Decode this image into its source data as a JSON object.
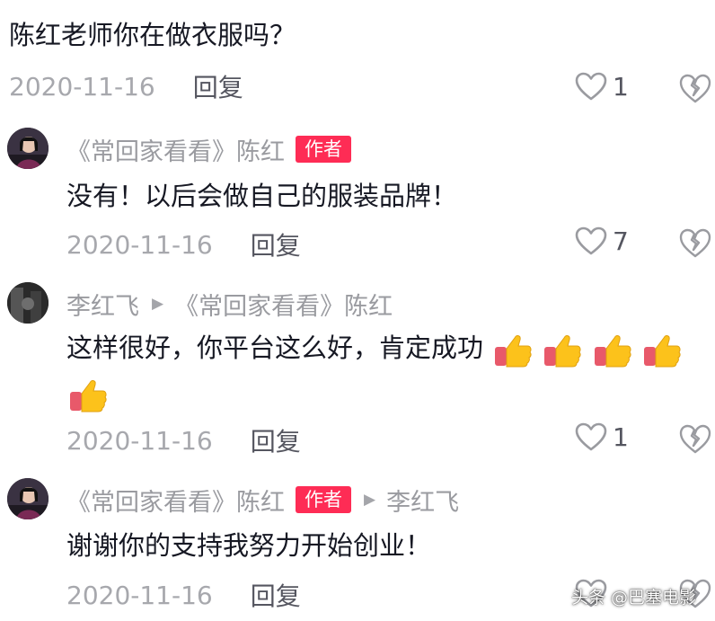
{
  "comments": [
    {
      "text": "陈红老师你在做衣服吗？",
      "date": "2020-11-16",
      "reply_label": "回复",
      "likes": "1"
    },
    {
      "author": "《常回家看看》陈红",
      "badge": "作者",
      "text": "没有！以后会做自己的服装品牌！",
      "date": "2020-11-16",
      "reply_label": "回复",
      "likes": "7"
    },
    {
      "author": "李红飞",
      "reply_to": "《常回家看看》陈红",
      "text": "这样很好，你平台这么好，肯定成功",
      "emoji": "thumbs-up ×5",
      "date": "2020-11-16",
      "reply_label": "回复",
      "likes": "1"
    },
    {
      "author": "《常回家看看》陈红",
      "badge": "作者",
      "reply_to": "李红飞",
      "text": "谢谢你的支持我努力开始创业！",
      "date": "2020-11-16",
      "reply_label": "回复"
    }
  ],
  "watermark": "头条 @巴塞电影",
  "colors": {
    "badge": "#fe2c55",
    "meta": "#a7a8ad",
    "text": "#161823"
  },
  "icons": [
    "heart-icon",
    "broken-heart-icon",
    "play-arrow-icon",
    "thumbs-up-emoji"
  ]
}
